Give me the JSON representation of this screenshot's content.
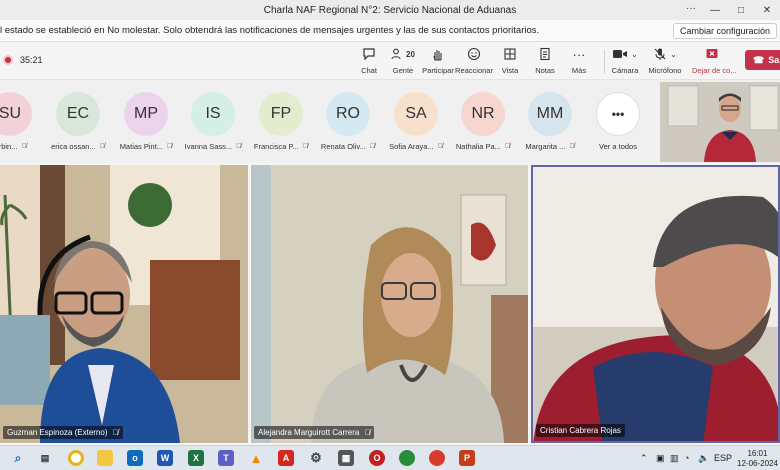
{
  "window": {
    "title": "Charla NAF Regional N°2: Servicio Nacional de Aduanas",
    "more": "···",
    "minimize": "—",
    "maximize": "□",
    "close": "✕"
  },
  "notice": {
    "text": "l estado se estableció en No molestar. Solo obtendrá las notificaciones de mensajes urgentes y las de sus contactos prioritarios.",
    "button": "Cambiar configuración"
  },
  "toolbar": {
    "timer": "35:21",
    "items": [
      {
        "label": "Chat",
        "icon": "chat-icon"
      },
      {
        "label": "Gente",
        "icon": "people-icon",
        "count": "20"
      },
      {
        "label": "Participar",
        "icon": "raise-hand-icon"
      },
      {
        "label": "Reaccionar",
        "icon": "smiley-icon"
      },
      {
        "label": "Vista",
        "icon": "grid-icon"
      },
      {
        "label": "Notas",
        "icon": "notes-icon"
      },
      {
        "label": "Más",
        "icon": "more-icon"
      },
      {
        "label": "Cámara",
        "icon": "camera-icon"
      },
      {
        "label": "Micrófono",
        "icon": "mic-icon"
      },
      {
        "label": "Dejar de co...",
        "icon": "stop-share-icon"
      }
    ],
    "leave": "Sa"
  },
  "participants": [
    {
      "initials": "SU",
      "name": "Urbin...",
      "color": "#f3d1d8"
    },
    {
      "initials": "EC",
      "name": "erica ossan...",
      "color": "#d7e7d9"
    },
    {
      "initials": "MP",
      "name": "Matias Pint...",
      "color": "#ecd3ec"
    },
    {
      "initials": "IS",
      "name": "Ivanna Sass...",
      "color": "#d4efe3"
    },
    {
      "initials": "FP",
      "name": "Francisca P...",
      "color": "#e3eccf"
    },
    {
      "initials": "RO",
      "name": "Renata Oliv...",
      "color": "#d4e9f2"
    },
    {
      "initials": "SA",
      "name": "Sofia Araya...",
      "color": "#f7e1cc"
    },
    {
      "initials": "NR",
      "name": "Nathalia Pa...",
      "color": "#f6d6cf"
    },
    {
      "initials": "MM",
      "name": "Margarita ...",
      "color": "#d6e4ee"
    },
    {
      "initials": "•••",
      "name": "Ver a todos",
      "color": "#ffffff"
    }
  ],
  "tiles": [
    {
      "name": "Guzman Espinoza (Externo)"
    },
    {
      "name": "Alejandra Marguirott Carrera"
    },
    {
      "name": "Cristian Cabrera Rojas"
    }
  ],
  "taskbar": {
    "lang": "ESP",
    "time": "16:01",
    "date": "12-06-2024"
  }
}
